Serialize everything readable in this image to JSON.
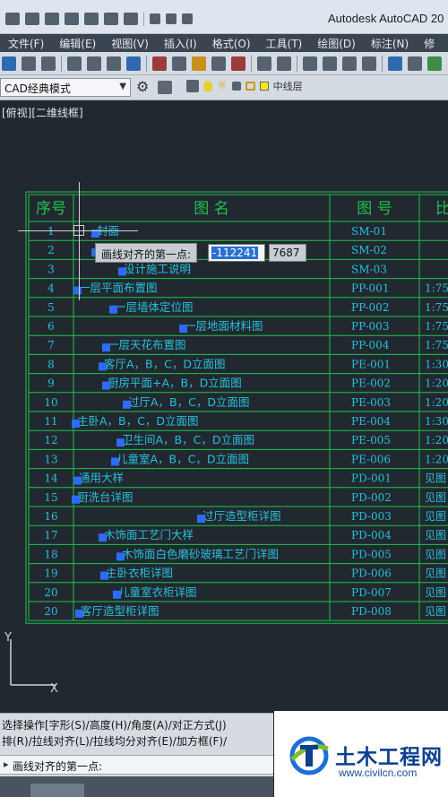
{
  "app": {
    "title": "Autodesk AutoCAD 20"
  },
  "menubar": {
    "items": [
      "文件(F)",
      "编辑(E)",
      "视图(V)",
      "插入(I)",
      "格式(O)",
      "工具(T)",
      "绘图(D)",
      "标注(N)",
      "修"
    ]
  },
  "toolbar2": {
    "workspace": "CAD经典模式",
    "layer_name": "中线层"
  },
  "viewport": {
    "label": "[俯视][二维线框]"
  },
  "table": {
    "headers": {
      "seq": "序号",
      "name": "图    名",
      "no": "图  号",
      "extra": "比"
    },
    "rows": [
      {
        "seq": "1",
        "name": "封面",
        "no": "SM-01",
        "extra": ""
      },
      {
        "seq": "2",
        "name": "",
        "no": "SM-02",
        "extra": ""
      },
      {
        "seq": "3",
        "name": "设计施工说明",
        "no": "SM-03",
        "extra": ""
      },
      {
        "seq": "4",
        "name": "一层平面布置图",
        "no": "PP-001",
        "extra": "1:75"
      },
      {
        "seq": "5",
        "name": "一层墙体定位图",
        "no": "PP-002",
        "extra": "1:75"
      },
      {
        "seq": "6",
        "name": "一层地面材料图",
        "no": "PP-003",
        "extra": "1:75"
      },
      {
        "seq": "7",
        "name": "一层天花布置图",
        "no": "PP-004",
        "extra": "1:75"
      },
      {
        "seq": "8",
        "name": "客厅A，B，C，D立面图",
        "no": "PE-001",
        "extra": "1:30"
      },
      {
        "seq": "9",
        "name": "厨房平面+A，B，D立面图",
        "no": "PE-002",
        "extra": "1:20"
      },
      {
        "seq": "10",
        "name": "过厅A，B，C，D立面图",
        "no": "PE-003",
        "extra": "1:20"
      },
      {
        "seq": "11",
        "name": "主卧A，B，C，D立面图",
        "no": "PE-004",
        "extra": "1:30"
      },
      {
        "seq": "12",
        "name": "卫生间A，B，C，D立面图",
        "no": "PE-005",
        "extra": "1:20"
      },
      {
        "seq": "13",
        "name": "儿童室A，B，C，D立面图",
        "no": "PE-006",
        "extra": "1:20"
      },
      {
        "seq": "14",
        "name": "通用大样",
        "no": "PD-001",
        "extra": "见图"
      },
      {
        "seq": "15",
        "name": "厨洗台详图",
        "no": "PD-002",
        "extra": "见图"
      },
      {
        "seq": "16",
        "name": "过厅造型柜详图",
        "no": "PD-003",
        "extra": "见图"
      },
      {
        "seq": "17",
        "name": "木饰面工艺门大样",
        "no": "PD-004",
        "extra": "见图"
      },
      {
        "seq": "18",
        "name": "木饰面白色磨砂玻璃工艺门详图",
        "no": "PD-005",
        "extra": "见图"
      },
      {
        "seq": "19",
        "name": "主卧衣柜详图",
        "no": "PD-006",
        "extra": "见图"
      },
      {
        "seq": "20",
        "name": "儿童室衣柜详图",
        "no": "PD-007",
        "extra": "见图"
      },
      {
        "seq": "20",
        "name": "客厅造型柜详图",
        "no": "PD-008",
        "extra": "见图"
      }
    ]
  },
  "ucs": {
    "y_label": "Y",
    "x_label": "X"
  },
  "dynamic_input": {
    "prompt": "画线对齐的第一点:",
    "x_value": "-112241",
    "y_value": "7687"
  },
  "command": {
    "history_1": "选择操作[字形(S)/高度(H)/角度(A)/对正方式(J)",
    "history_2": "排(R)/拉线对齐(L)/拉线均分对齐(E)/加方框(F)/",
    "current": "画线对齐的第一点:"
  },
  "logo": {
    "title": "土木工程网",
    "url": "www.civilcn.com"
  },
  "colors": {
    "canvas": "#212830",
    "table_line": "#1fc44a",
    "table_text": "#27c0d8",
    "grip": "#2d6bff"
  }
}
